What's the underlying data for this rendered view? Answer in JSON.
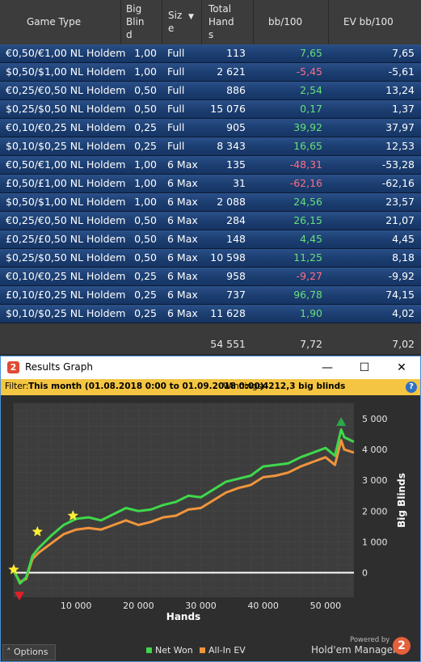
{
  "table": {
    "headers": {
      "game_type": "Game Type",
      "big_blind": [
        "Big",
        "Blin",
        "d"
      ],
      "size": [
        "Siz",
        "e"
      ],
      "total_hands": [
        "Total",
        "Hand",
        "s"
      ],
      "bb100": "bb/100",
      "ev_bb100": "EV bb/100"
    },
    "rows": [
      {
        "game": "€0,50/€1,00 NL Holdem",
        "bb": "1,00",
        "size": "Full",
        "hands": "113",
        "bb100": "7,65",
        "ev": "7,65",
        "sign": "pos"
      },
      {
        "game": "$0,50/$1,00 NL Holdem",
        "bb": "1,00",
        "size": "Full",
        "hands": "2 621",
        "bb100": "-5,45",
        "ev": "-5,61",
        "sign": "neg"
      },
      {
        "game": "€0,25/€0,50 NL Holdem",
        "bb": "0,50",
        "size": "Full",
        "hands": "886",
        "bb100": "2,54",
        "ev": "13,24",
        "sign": "pos"
      },
      {
        "game": "$0,25/$0,50 NL Holdem",
        "bb": "0,50",
        "size": "Full",
        "hands": "15 076",
        "bb100": "0,17",
        "ev": "1,37",
        "sign": "pos"
      },
      {
        "game": "€0,10/€0,25 NL Holdem",
        "bb": "0,25",
        "size": "Full",
        "hands": "905",
        "bb100": "39,92",
        "ev": "37,97",
        "sign": "pos"
      },
      {
        "game": "$0,10/$0,25 NL Holdem",
        "bb": "0,25",
        "size": "Full",
        "hands": "8 343",
        "bb100": "16,65",
        "ev": "12,53",
        "sign": "pos"
      },
      {
        "game": "€0,50/€1,00 NL Holdem",
        "bb": "1,00",
        "size": "6 Max",
        "hands": "135",
        "bb100": "-48,31",
        "ev": "-53,28",
        "sign": "neg"
      },
      {
        "game": "£0,50/£1,00 NL Holdem",
        "bb": "1,00",
        "size": "6 Max",
        "hands": "31",
        "bb100": "-62,16",
        "ev": "-62,16",
        "sign": "neg"
      },
      {
        "game": "$0,50/$1,00 NL Holdem",
        "bb": "1,00",
        "size": "6 Max",
        "hands": "2 088",
        "bb100": "24,56",
        "ev": "23,57",
        "sign": "pos"
      },
      {
        "game": "€0,25/€0,50 NL Holdem",
        "bb": "0,50",
        "size": "6 Max",
        "hands": "284",
        "bb100": "26,15",
        "ev": "21,07",
        "sign": "pos"
      },
      {
        "game": "£0,25/£0,50 NL Holdem",
        "bb": "0,50",
        "size": "6 Max",
        "hands": "148",
        "bb100": "4,45",
        "ev": "4,45",
        "sign": "pos"
      },
      {
        "game": "$0,25/$0,50 NL Holdem",
        "bb": "0,50",
        "size": "6 Max",
        "hands": "10 598",
        "bb100": "11,25",
        "ev": "8,18",
        "sign": "pos"
      },
      {
        "game": "€0,10/€0,25 NL Holdem",
        "bb": "0,25",
        "size": "6 Max",
        "hands": "958",
        "bb100": "-9,27",
        "ev": "-9,92",
        "sign": "neg"
      },
      {
        "game": "£0,10/£0,25 NL Holdem",
        "bb": "0,25",
        "size": "6 Max",
        "hands": "737",
        "bb100": "96,78",
        "ev": "74,15",
        "sign": "pos"
      },
      {
        "game": "$0,10/$0,25 NL Holdem",
        "bb": "0,25",
        "size": "6 Max",
        "hands": "11 628",
        "bb100": "1,90",
        "ev": "4,02",
        "sign": "pos"
      }
    ],
    "totals": {
      "hands": "54 551",
      "bb100": "7,72",
      "ev": "7,02"
    }
  },
  "window": {
    "title": "Results Graph",
    "app_icon": "2",
    "icons": [
      "minimize-icon",
      "maximize-icon",
      "close-icon",
      "help-icon"
    ],
    "filter": {
      "label": "Filter:",
      "value": "This month (01.08.2018 0:00 to 01.09.2018 0:00)",
      "winnings_label": "Winnings:",
      "winnings_value": "4212,3 big blinds"
    },
    "options_label": "Options",
    "legend": [
      {
        "name": "Net Won",
        "color": "#3fd84a"
      },
      {
        "name": "All-In EV",
        "color": "#f0953c"
      }
    ],
    "powered_by": "Powered by",
    "brand": "Hold'em Manager",
    "brand_icon": "2"
  },
  "colors": {
    "positive": "#66e07a",
    "negative": "#ff6e86",
    "filter_bar": "#f4c542",
    "net_won": "#3fd84a",
    "all_in_ev": "#f0953c"
  },
  "chart_data": {
    "type": "line",
    "xlabel": "Hands",
    "ylabel": "Big Blinds",
    "x_ticks": [
      "10 000",
      "20 000",
      "30 000",
      "40 000",
      "50 000"
    ],
    "x_tick_values": [
      10000,
      20000,
      30000,
      40000,
      50000
    ],
    "y_ticks": [
      "0",
      "1 000",
      "2 000",
      "3 000",
      "4 000",
      "5 000"
    ],
    "y_tick_values": [
      0,
      1000,
      2000,
      3000,
      4000,
      5000
    ],
    "xlim": [
      0,
      54551
    ],
    "ylim": [
      -800,
      5500
    ],
    "grid": true,
    "legend_position": "bottom",
    "series": [
      {
        "name": "Net Won",
        "color": "#3fd84a",
        "x": [
          0,
          1000,
          2000,
          3000,
          4000,
          5000,
          6000,
          8000,
          10000,
          12000,
          14000,
          16000,
          18000,
          20000,
          22000,
          24000,
          26000,
          28000,
          30000,
          32000,
          34000,
          36000,
          38000,
          40000,
          42000,
          44000,
          46000,
          48000,
          50000,
          51500,
          52500,
          53000,
          54551
        ],
        "y": [
          100,
          -350,
          -150,
          550,
          800,
          1000,
          1200,
          1550,
          1750,
          1800,
          1700,
          1900,
          2100,
          2000,
          2050,
          2200,
          2300,
          2500,
          2450,
          2700,
          2950,
          3050,
          3150,
          3450,
          3500,
          3550,
          3750,
          3900,
          4050,
          3800,
          4650,
          4400,
          4250
        ]
      },
      {
        "name": "All-In EV",
        "color": "#f0953c",
        "x": [
          0,
          1000,
          2000,
          3000,
          4000,
          5000,
          6000,
          8000,
          10000,
          12000,
          14000,
          16000,
          18000,
          20000,
          22000,
          24000,
          26000,
          28000,
          30000,
          32000,
          34000,
          36000,
          38000,
          40000,
          42000,
          44000,
          46000,
          48000,
          50000,
          51500,
          52500,
          53000,
          54551
        ],
        "y": [
          50,
          -300,
          -200,
          450,
          650,
          800,
          950,
          1250,
          1400,
          1450,
          1400,
          1550,
          1700,
          1550,
          1650,
          1800,
          1850,
          2050,
          2100,
          2350,
          2600,
          2750,
          2850,
          3100,
          3150,
          3250,
          3450,
          3600,
          3750,
          3500,
          4300,
          4000,
          3900
        ]
      }
    ],
    "markers": [
      {
        "type": "star",
        "color": "#ffee33",
        "x": 0,
        "y": 100
      },
      {
        "type": "star",
        "color": "#ffee33",
        "x": 3800,
        "y": 1330
      },
      {
        "type": "star",
        "color": "#ffee33",
        "x": 9500,
        "y": 1850
      },
      {
        "type": "triangle-down",
        "color": "#e0202a",
        "x": 900,
        "y": -750
      },
      {
        "type": "triangle-up",
        "color": "#2aa84a",
        "x": 52500,
        "y": 4900
      }
    ]
  }
}
